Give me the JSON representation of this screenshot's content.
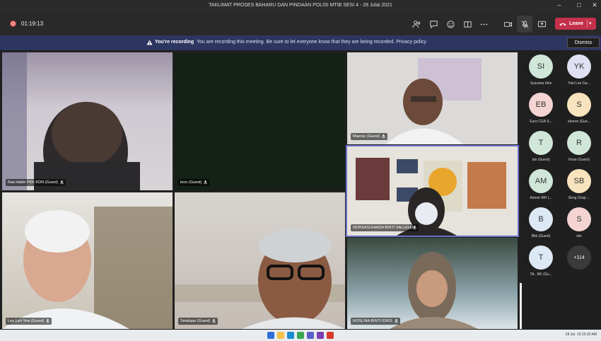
{
  "window": {
    "title": "TAKLIMAT PROSES BAHARU DAN PINDAAN POLISI MTIB SESI 4 - 28 Julai 2021",
    "controls": [
      "minimize-icon",
      "maximize-icon",
      "close-icon"
    ]
  },
  "toolbar": {
    "timer": "01:19:13",
    "buttons": [
      "people-icon",
      "chat-icon",
      "reactions-icon",
      "rooms-icon",
      "more-icon",
      "camera-icon",
      "mic-off-icon",
      "share-icon"
    ],
    "leave_label": "Leave"
  },
  "banner": {
    "bold": "You're recording",
    "text": "You are recording this meeting. Be sure to let everyone know that they are being recorded. Privacy policy",
    "dismiss_label": "Dismiss"
  },
  "tiles": [
    {
      "name": "Ras Halim PKK KDN (Guest)"
    },
    {
      "name": "leon (Guest)"
    },
    {
      "name": "Mazree (Guest)"
    },
    {
      "name": "NORSASUHAIDA BINTI SALLEH"
    },
    {
      "name": "Lee Leh Yew (Guest)"
    },
    {
      "name": "Smahpar (Guest)"
    },
    {
      "name": "ROSLINA BINTI IDRIS"
    }
  ],
  "roster": [
    {
      "initials": "SI",
      "name": "Syazana Idris",
      "color": "#cfe6d8"
    },
    {
      "initials": "YK",
      "name": "Yuki Lee Ga...",
      "color": "#dfe0f2"
    },
    {
      "initials": "EB",
      "name": "Euro CGA S...",
      "color": "#f4d3d3"
    },
    {
      "initials": "S",
      "name": "sharon (Gue...",
      "color": "#f7e3bd"
    },
    {
      "initials": "T",
      "name": "Ian (Guest)",
      "color": "#cfe6d8"
    },
    {
      "initials": "R",
      "name": "Rose (Guest)",
      "color": "#cfe6d8"
    },
    {
      "initials": "AM",
      "name": "Ameer MH (...",
      "color": "#cfe6d8"
    },
    {
      "initials": "SB",
      "name": "Seng Chap ...",
      "color": "#f7e3bd"
    },
    {
      "initials": "B",
      "name": "Bkb (Guest)",
      "color": "#dce8f4"
    },
    {
      "initials": "S",
      "name": "ske",
      "color": "#f4d3d3"
    },
    {
      "initials": "T",
      "name": "TA...NK (Gu...",
      "color": "#dce8f4"
    },
    {
      "initials": "+114",
      "name": "",
      "color": "#3a3a3a"
    }
  ],
  "taskbar": {
    "date": "28 Jul",
    "time": "10:15:20 AM"
  }
}
